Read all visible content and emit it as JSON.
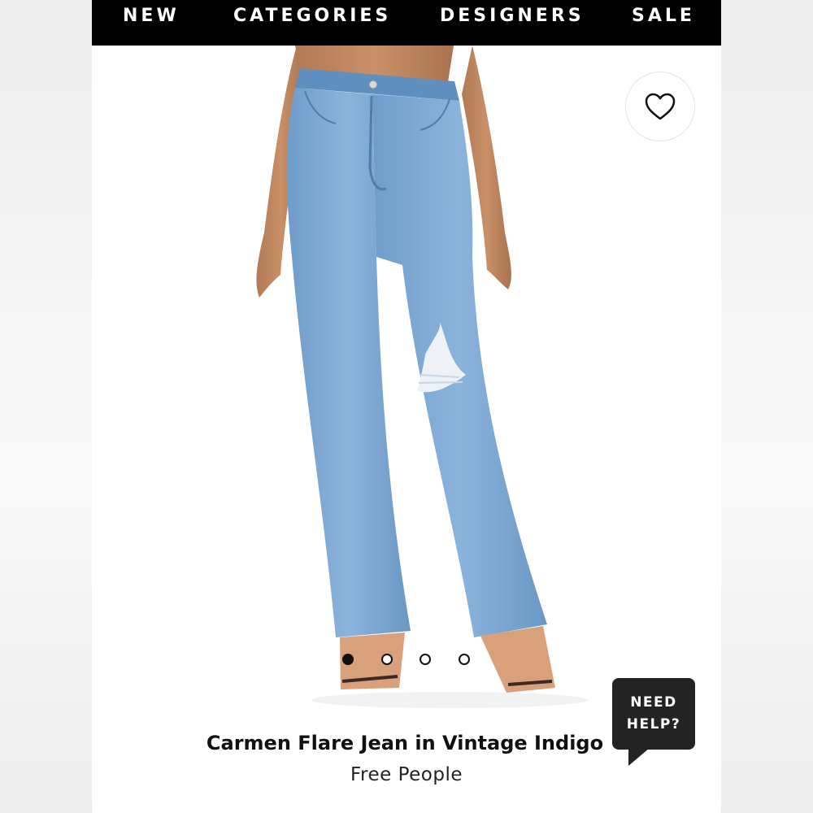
{
  "nav": {
    "items": [
      "NEW",
      "CATEGORIES",
      "DESIGNERS",
      "SALE"
    ]
  },
  "product": {
    "title": "Carmen Flare Jean in Vintage Indigo",
    "brand": "Free People",
    "image_icon": "product-photo-jeans",
    "carousel": {
      "total": 4,
      "active": 1
    }
  },
  "help": {
    "line1": "NEED",
    "line2": "HELP?"
  },
  "colors": {
    "nav_bg": "#000000",
    "denim": "#7aa6d3",
    "help_bg": "#232323"
  }
}
